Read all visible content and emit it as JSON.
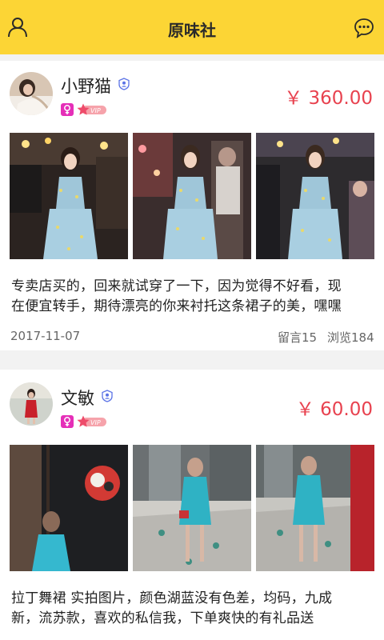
{
  "app": {
    "title": "原味社",
    "colors": {
      "header_bg": "#fcd535",
      "price": "#e8424f",
      "gender": "#e52fb8",
      "verified": "#5b73e6",
      "vip": "#f26d7c"
    }
  },
  "header": {
    "left_icon": "user-profile-icon",
    "right_icon": "chat-bubble-icon"
  },
  "posts": [
    {
      "username": "小野猫",
      "price": "￥ 360.00",
      "badges": [
        "verified-icon",
        "female-icon",
        "vip-badge"
      ],
      "vip_text": "VIP",
      "description_line1": "专卖店买的，回来就试穿了一下，因为觉得不好看，现",
      "description_line2": "在便宜转手，期待漂亮的你来衬托这条裙子的美，嘿嘿",
      "date": "2017-11-07",
      "comments": "留言15",
      "views": "浏览184"
    },
    {
      "username": "文敏",
      "price": "￥ 60.00",
      "badges": [
        "verified-icon",
        "female-icon",
        "vip-badge"
      ],
      "vip_text": "VIP",
      "description_line1": "拉丁舞裙 实拍图片，颜色湖蓝没有色差，均码，九成",
      "description_line2": "新，流苏款，喜欢的私信我，下单爽快的有礼品送"
    }
  ]
}
